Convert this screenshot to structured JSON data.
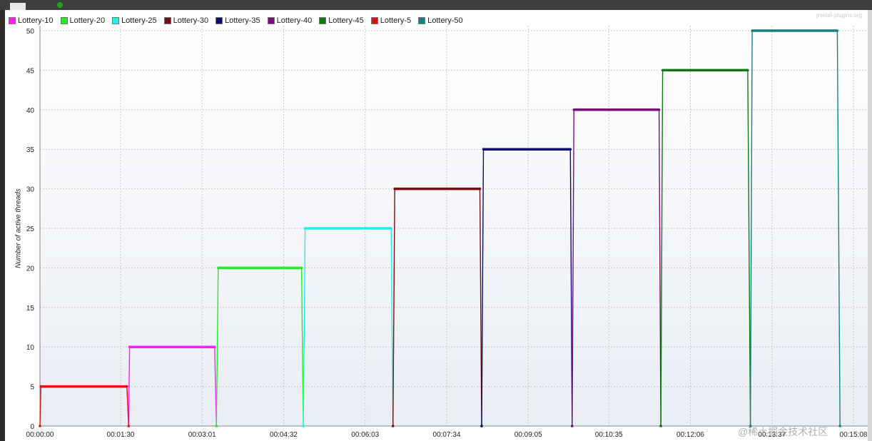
{
  "watermarks": {
    "top": "jmeter-plugins.org",
    "bottom": "@稀土掘金技术社区"
  },
  "chart_data": {
    "type": "line",
    "title": "",
    "xlabel": "",
    "ylabel": "Number of active threads",
    "ylim": [
      0,
      50
    ],
    "yticks": [
      "0",
      "5",
      "10",
      "15",
      "20",
      "25",
      "30",
      "35",
      "40",
      "45",
      "50"
    ],
    "xticks": [
      "00:00:00",
      "00:01:30",
      "00:03:01",
      "00:04:32",
      "00:06:03",
      "00:07:34",
      "00:09:05",
      "00:10:35",
      "00:12:06",
      "00:13:37",
      "00:15:08"
    ],
    "grid": true,
    "legend_position": "top-left",
    "series": [
      {
        "name": "Lottery-10",
        "color": "#ff1cff",
        "points": [
          [
            "00:01:39",
            0
          ],
          [
            "00:01:40",
            10
          ],
          [
            "00:03:15",
            10
          ],
          [
            "00:03:17",
            0
          ]
        ]
      },
      {
        "name": "Lottery-20",
        "color": "#22ee22",
        "points": [
          [
            "00:03:17",
            0
          ],
          [
            "00:03:19",
            20
          ],
          [
            "00:04:52",
            20
          ],
          [
            "00:04:54",
            0
          ]
        ]
      },
      {
        "name": "Lottery-25",
        "color": "#22eeee",
        "points": [
          [
            "00:04:54",
            0
          ],
          [
            "00:04:56",
            25
          ],
          [
            "00:06:32",
            25
          ],
          [
            "00:06:34",
            0
          ]
        ]
      },
      {
        "name": "Lottery-30",
        "color": "#7a0f0f",
        "points": [
          [
            "00:06:34",
            0
          ],
          [
            "00:06:36",
            30
          ],
          [
            "00:08:11",
            30
          ],
          [
            "00:08:13",
            0
          ]
        ]
      },
      {
        "name": "Lottery-35",
        "color": "#0c0c70",
        "points": [
          [
            "00:08:13",
            0
          ],
          [
            "00:08:15",
            35
          ],
          [
            "00:09:52",
            35
          ],
          [
            "00:09:54",
            0
          ]
        ]
      },
      {
        "name": "Lottery-40",
        "color": "#7a0f7a",
        "points": [
          [
            "00:09:54",
            0
          ],
          [
            "00:09:56",
            40
          ],
          [
            "00:11:31",
            40
          ],
          [
            "00:11:33",
            0
          ]
        ]
      },
      {
        "name": "Lottery-45",
        "color": "#117711",
        "points": [
          [
            "00:11:33",
            0
          ],
          [
            "00:11:35",
            45
          ],
          [
            "00:13:10",
            45
          ],
          [
            "00:13:13",
            0
          ]
        ]
      },
      {
        "name": "Lottery-5",
        "color": "#e01010",
        "points": [
          [
            "00:00:00",
            0
          ],
          [
            "00:00:01",
            5
          ],
          [
            "00:01:37",
            5
          ],
          [
            "00:01:39",
            0
          ]
        ]
      },
      {
        "name": "Lottery-50",
        "color": "#178080",
        "points": [
          [
            "00:13:13",
            0
          ],
          [
            "00:13:15",
            50
          ],
          [
            "00:14:50",
            50
          ],
          [
            "00:14:53",
            0
          ]
        ]
      }
    ]
  }
}
